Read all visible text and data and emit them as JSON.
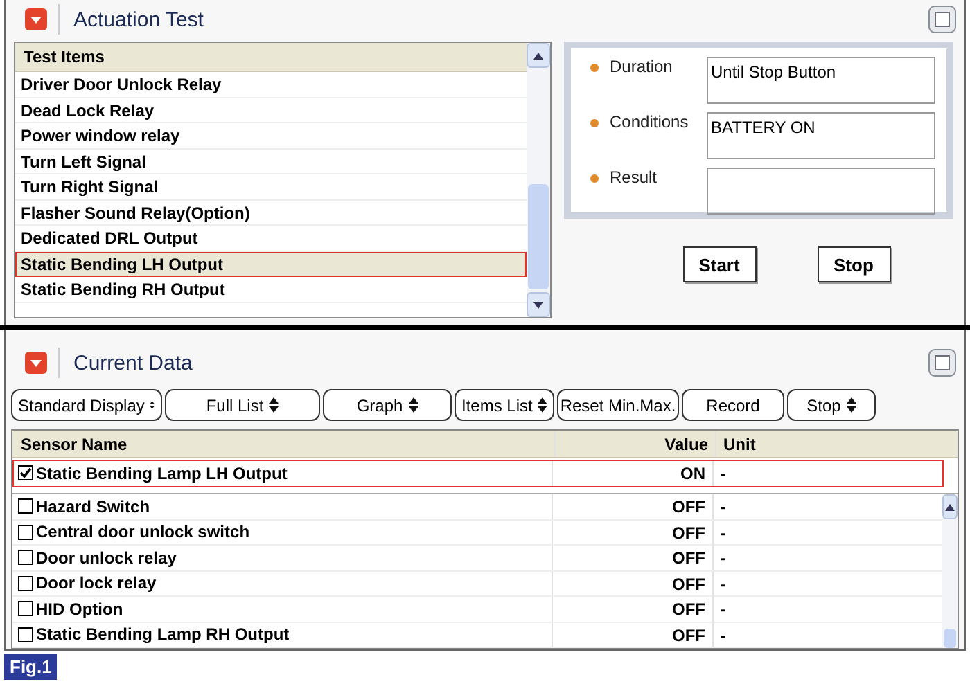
{
  "actuation_test": {
    "title": "Actuation Test",
    "list": {
      "header": "Test Items",
      "items": [
        {
          "label": "Driver Door Unlock Relay",
          "selected": false
        },
        {
          "label": "Dead Lock Relay",
          "selected": false
        },
        {
          "label": "Power window relay",
          "selected": false
        },
        {
          "label": "Turn Left Signal",
          "selected": false
        },
        {
          "label": "Turn Right Signal",
          "selected": false
        },
        {
          "label": "Flasher Sound Relay(Option)",
          "selected": false
        },
        {
          "label": "Dedicated DRL Output",
          "selected": false
        },
        {
          "label": "Static Bending LH Output",
          "selected": true
        },
        {
          "label": "Static Bending RH Output",
          "selected": false
        }
      ]
    },
    "info": [
      {
        "label": "Duration",
        "value": "Until Stop Button"
      },
      {
        "label": "Conditions",
        "value": "BATTERY ON"
      },
      {
        "label": "Result"
      }
    ],
    "buttons": [
      "Start",
      "Stop"
    ]
  },
  "current_data": {
    "title": "Current Data",
    "toolbar": [
      {
        "label": "Standard Display",
        "dropdown": true
      },
      {
        "label": "Full List",
        "dropdown": true
      },
      {
        "label": "Graph",
        "dropdown": true
      },
      {
        "label": "Items List",
        "dropdown": true
      },
      {
        "label": "Reset Min.Max.",
        "dropdown": false
      },
      {
        "label": "Record",
        "dropdown": false
      },
      {
        "label": "Stop",
        "dropdown": true
      }
    ],
    "columns": [
      "Sensor Name",
      "Value",
      "Unit"
    ],
    "pinned_rows": [
      {
        "name": "Static Bending Lamp LH Output",
        "checked": true,
        "value": "ON",
        "unit": "-"
      }
    ],
    "rows": [
      {
        "name": "Hazard Switch",
        "checked": false,
        "value": "OFF",
        "unit": "-"
      },
      {
        "name": "Central door unlock switch",
        "checked": false,
        "value": "OFF",
        "unit": "-"
      },
      {
        "name": "Door unlock relay",
        "checked": false,
        "value": "OFF",
        "unit": "-"
      },
      {
        "name": "Door lock relay",
        "checked": false,
        "value": "OFF",
        "unit": "-"
      },
      {
        "name": "HID Option",
        "checked": false,
        "value": "OFF",
        "unit": "-"
      },
      {
        "name": "Static Bending Lamp RH Output",
        "checked": false,
        "value": "OFF",
        "unit": "-"
      }
    ]
  },
  "figure_label": "Fig.1"
}
